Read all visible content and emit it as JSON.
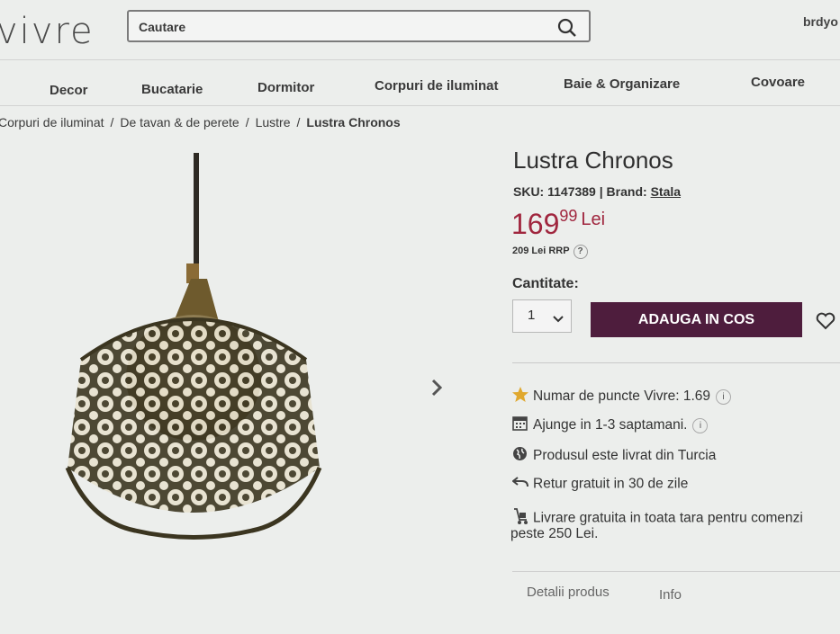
{
  "header": {
    "logo": "vivre",
    "search_placeholder": "Cautare",
    "user": "brdyo"
  },
  "nav": [
    "Decor",
    "Bucatarie",
    "Dormitor",
    "Corpuri de iluminat",
    "Baie & Organizare",
    "Covoare"
  ],
  "breadcrumb": [
    "Corpuri de iluminat",
    "De tavan & de perete",
    "Lustre",
    "Lustra Chronos"
  ],
  "product": {
    "title": "Lustra Chronos",
    "sku_label": "SKU: 1147389 |",
    "brand_label": "Brand:",
    "brand": "Stala",
    "price_int": "169",
    "price_dec": "99",
    "currency": "Lei",
    "rrp": "209 Lei RRP",
    "qty_label": "Cantitate:",
    "qty_value": "1",
    "add_to_cart": "ADAUGA IN COS"
  },
  "features": [
    "Numar de puncte Vivre: 1.69",
    "Ajunge in 1-3 saptamani.",
    "Produsul este livrat din Turcia",
    "Retur gratuit in 30 de zile",
    "Livrare gratuita in toata tara pentru comenzi",
    "peste 250 Lei."
  ],
  "tabs": [
    "Detalii produs",
    "Info"
  ],
  "colors": {
    "accent_button": "#4e1d3d",
    "price": "#a0263e"
  },
  "icons": [
    "search-icon",
    "chevron-down-icon",
    "heart-icon",
    "star-icon",
    "calendar-icon",
    "globe-icon",
    "return-icon",
    "delivery-icon",
    "chevron-right-icon"
  ]
}
